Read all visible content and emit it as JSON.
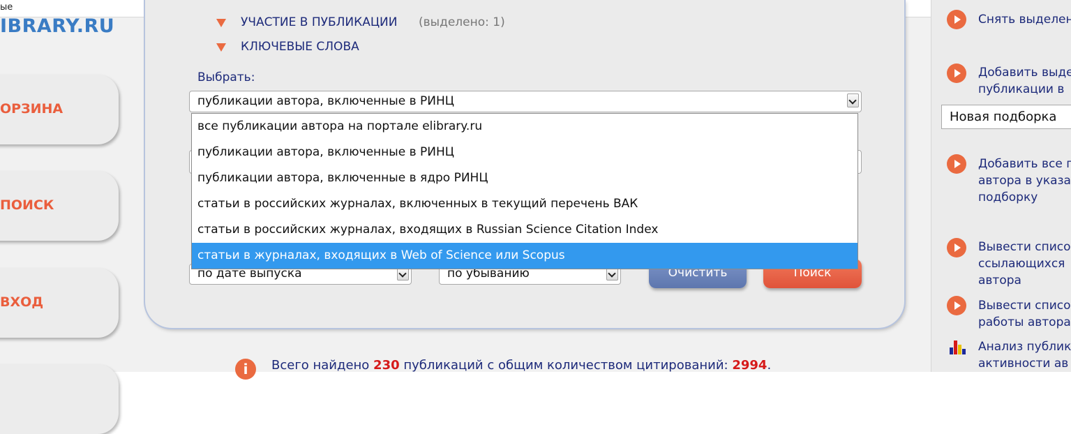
{
  "topbar": {
    "text": "ые"
  },
  "logo": {
    "text": "IBRARY.RU"
  },
  "nav": {
    "items": [
      {
        "label": "ОРЗИНА"
      },
      {
        "label": "ПОИСК"
      },
      {
        "label": "ВХОД"
      }
    ]
  },
  "panel": {
    "accordion": [
      {
        "label": "УЧАСТИЕ В ПУБЛИКАЦИИ",
        "extra": "(выделено: 1)"
      },
      {
        "label": "КЛЮЧЕВЫЕ СЛОВА"
      }
    ],
    "choose_label": "Выбрать:",
    "select_value": "публикации автора, включенные в РИНЦ",
    "dropdown_options": [
      "все публикации автора на портале elibrary.ru",
      "публикации автора, включенные в РИНЦ",
      "публикации автора, включенные в ядро РИНЦ",
      "статьи в российских журналах, включенных в текущий перечень ВАК",
      "статьи в российских журналах, входящих в Russian Science Citation Index",
      "статьи в журналах, входящих в Web of Science или Scopus"
    ],
    "sort_field": "по дате выпуска",
    "sort_order": "по убыванию",
    "clear_button": "Очистить",
    "search_button": "Поиск"
  },
  "info": {
    "icon": "info-icon",
    "text_before": "Всего найдено",
    "count": "230",
    "text_middle": "публикаций с общим количеством цитирований:",
    "citations": "2994",
    "text_after": "."
  },
  "sidebar": {
    "items": [
      {
        "lines": [
          "Снять выделен"
        ]
      },
      {
        "lines": [
          "Добавить выде",
          "публикации в"
        ]
      },
      {
        "lines": [
          "Добавить все п",
          "автора в указа",
          "подборку"
        ]
      },
      {
        "lines": [
          "Вывести списо",
          "ссылающихся",
          "автора"
        ]
      },
      {
        "lines": [
          "Вывести списо",
          "работы автора"
        ]
      },
      {
        "lines": [
          "Анализ публик",
          "активности ав"
        ]
      }
    ],
    "collection_select": "Новая подборка"
  },
  "colors": {
    "accent_orange": "#ea6a40",
    "nav_text": "#1d2a7a",
    "selected_option": "#3399ee",
    "button_blue": "#6a82b9"
  }
}
